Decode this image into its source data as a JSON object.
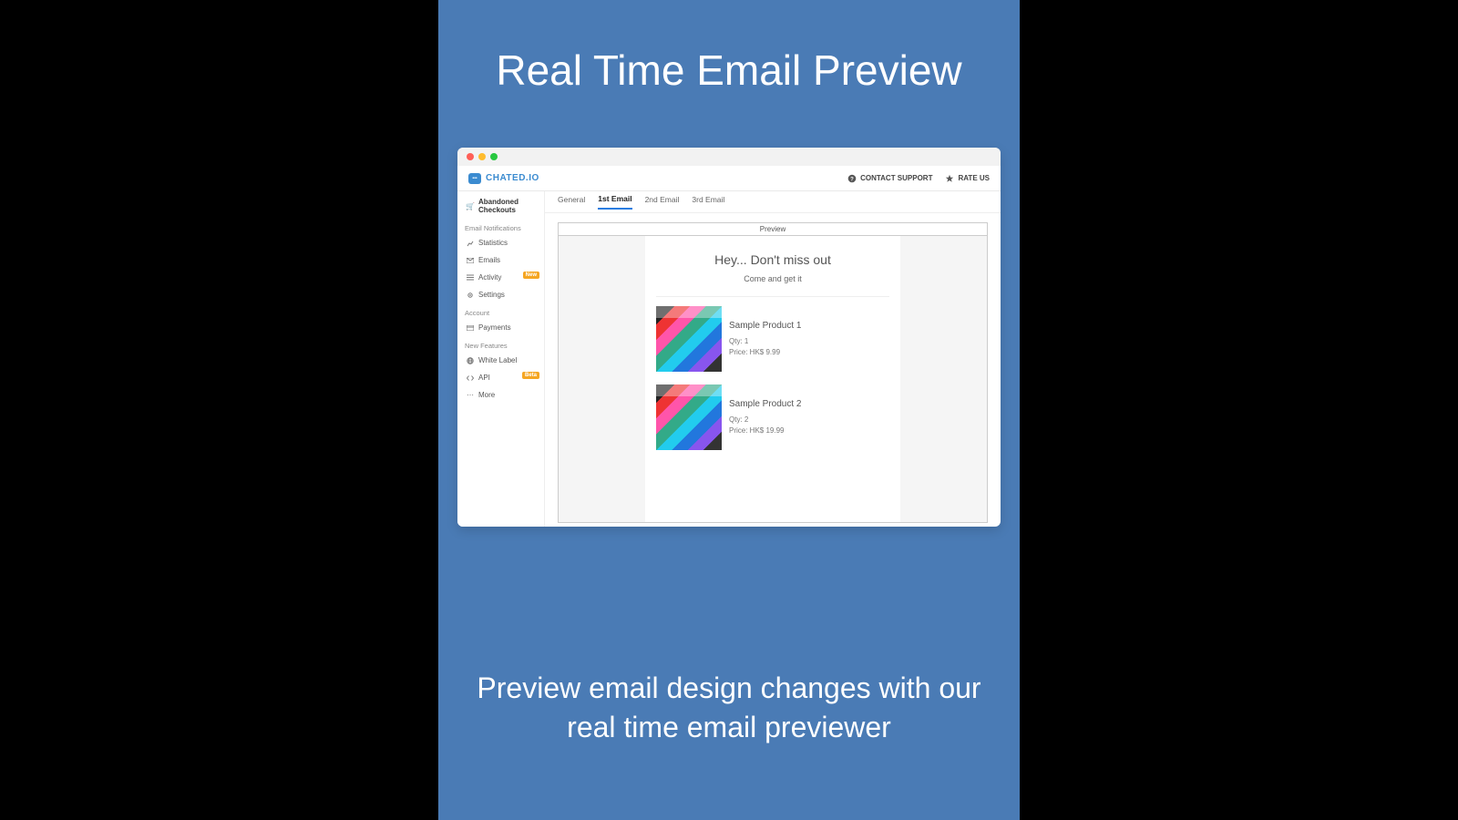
{
  "slide": {
    "title": "Real Time Email Preview",
    "caption": "Preview email design changes with our real time email previewer"
  },
  "header": {
    "brand": "CHATED.IO",
    "contact": "CONTACT SUPPORT",
    "rate": "RATE US"
  },
  "sidebar": {
    "top_item": "Abandoned Checkouts",
    "group1": "Email Notifications",
    "items1": [
      {
        "label": "Statistics",
        "icon": "chart"
      },
      {
        "label": "Emails",
        "icon": "mail"
      },
      {
        "label": "Activity",
        "icon": "list",
        "badge": "New"
      },
      {
        "label": "Settings",
        "icon": "gear"
      }
    ],
    "group2": "Account",
    "items2": [
      {
        "label": "Payments",
        "icon": "card"
      }
    ],
    "group3": "New Features",
    "items3": [
      {
        "label": "White Label",
        "icon": "globe"
      },
      {
        "label": "API",
        "icon": "code",
        "badge": "Beta"
      },
      {
        "label": "More",
        "icon": "dots"
      }
    ]
  },
  "tabs": [
    "General",
    "1st Email",
    "2nd Email",
    "3rd Email"
  ],
  "activeTab": "1st Email",
  "preview": {
    "label": "Preview",
    "headline": "Hey... Don't miss out",
    "subhead": "Come and get it",
    "products": [
      {
        "name": "Sample Product 1",
        "qty": "Qty: 1",
        "price": "Price: HK$ 9.99"
      },
      {
        "name": "Sample Product 2",
        "qty": "Qty: 2",
        "price": "Price: HK$ 19.99"
      }
    ]
  }
}
